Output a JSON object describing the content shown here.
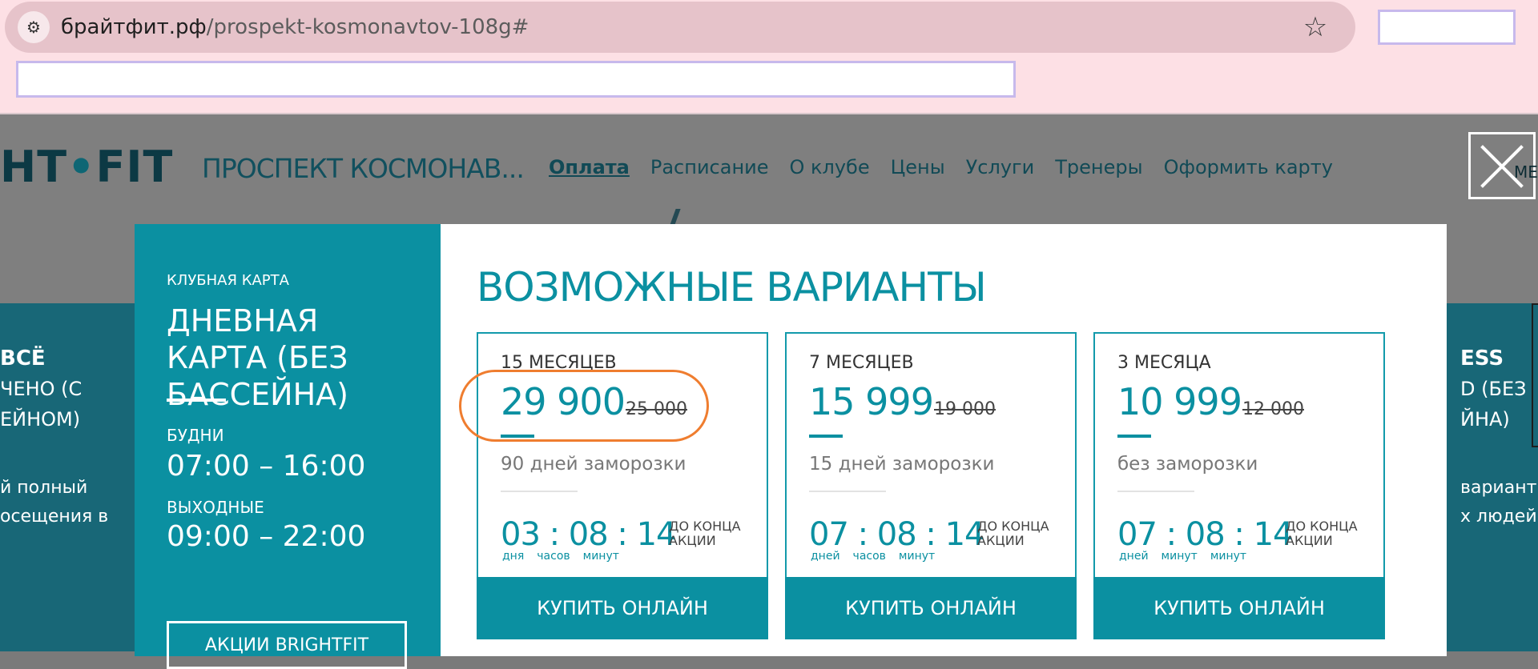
{
  "browser": {
    "url_host": "брайтфит.рф",
    "url_path": "/prospekt-kosmonavtov-108g#",
    "site_info_icon": "tune-icon",
    "bookmark_icon": "star-icon"
  },
  "site": {
    "logo_left": "HT",
    "logo_dot": "•",
    "logo_right": "FIT",
    "club_name": "ПРОСПЕКТ КОСМОНАВ...",
    "nav": [
      "Оплата",
      "Расписание",
      "О клубе",
      "Цены",
      "Услуги",
      "Тренеры",
      "Оформить карту"
    ],
    "menu_label": "МЕ",
    "left_card": {
      "title": "ВСЁ",
      "line1": "ЧЕНО (С",
      "line2": "ЕЙНОМ)",
      "desc1": "й полный",
      "desc2": "осещения в"
    },
    "right_card": {
      "title": "ESS",
      "line1": "D (БЕЗ",
      "line2": "ЙНА)",
      "desc1": "вариант",
      "desc2": "х людей"
    }
  },
  "modal": {
    "left": {
      "kicker": "КЛУБНАЯ КАРТА",
      "title": "ДНЕВНАЯ КАРТА (БЕЗ БАССЕЙНА)",
      "weekdays_label": "БУДНИ",
      "weekdays_time": "07:00 – 16:00",
      "weekend_label": "ВЫХОДНЫЕ",
      "weekend_time": "09:00 – 22:00",
      "promo_button": "АКЦИИ BRIGHTFIT"
    },
    "heading": "ВОЗМОЖНЫЕ ВАРИАНТЫ",
    "cards": [
      {
        "period": "15 МЕСЯЦЕВ",
        "price": "29 900",
        "old_price": "25 000",
        "freeze": "90 дней заморозки",
        "timer": "03 : 08 : 14",
        "units": [
          "дня",
          "часов",
          "минут"
        ],
        "until": "ДО КОНЦА АКЦИИ",
        "buy": "КУПИТЬ ОНЛАЙН"
      },
      {
        "period": "7 МЕСЯЦЕВ",
        "price": "15 999",
        "old_price": "19 000",
        "freeze": "15 дней заморозки",
        "timer": "07 : 08 : 14",
        "units": [
          "дней",
          "часов",
          "минут"
        ],
        "until": "ДО КОНЦА АКЦИИ",
        "buy": "КУПИТЬ ОНЛАЙН"
      },
      {
        "period": "3 МЕСЯЦА",
        "price": "10 999",
        "old_price": "12 000",
        "freeze": "без заморозки",
        "timer": "07 : 08 : 14",
        "units": [
          "дней",
          "минут",
          "минут"
        ],
        "until": "ДО КОНЦА АКЦИИ",
        "buy": "КУПИТЬ ОНЛАЙН"
      }
    ]
  },
  "colors": {
    "accent": "#0b90a1",
    "highlight": "#ef7d2f",
    "browser_bg": "#fde0e5"
  }
}
